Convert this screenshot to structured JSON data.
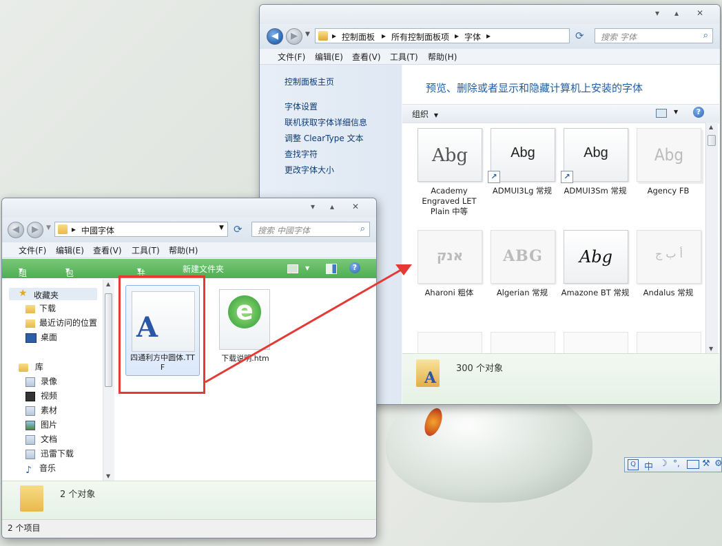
{
  "fonts_window": {
    "breadcrumb": [
      "控制面板",
      "所有控制面板项",
      "字体"
    ],
    "search_placeholder": "搜索 字体",
    "menus": [
      "文件(F)",
      "编辑(E)",
      "查看(V)",
      "工具(T)",
      "帮助(H)"
    ],
    "sidebar": {
      "home": "控制面板主页",
      "links": [
        "字体设置",
        "联机获取字体详细信息",
        "调整 ClearType 文本",
        "查找字符",
        "更改字体大小"
      ]
    },
    "heading": "预览、删除或者显示和隐藏计算机上安装的字体",
    "organize": "组织",
    "fonts": [
      {
        "preview": "Abg",
        "name": "Academy Engraved LET Plain 中等",
        "shortcut": false,
        "style": "serif",
        "stack": false
      },
      {
        "preview": "Abg",
        "name": "ADMUI3Lg 常规",
        "shortcut": true,
        "style": "sans",
        "stack": false
      },
      {
        "preview": "Abg",
        "name": "ADMUI3Sm 常规",
        "shortcut": true,
        "style": "sans",
        "stack": false
      },
      {
        "preview": "Abg",
        "name": "Agency FB",
        "shortcut": false,
        "style": "light",
        "stack": true
      },
      {
        "preview": "אנק",
        "name": "Aharoni 粗体",
        "shortcut": false,
        "style": "hebrew",
        "stack": false
      },
      {
        "preview": "ABG",
        "name": "Algerian 常规",
        "shortcut": false,
        "style": "algerian",
        "stack": false
      },
      {
        "preview": "Abg",
        "name": "Amazone BT 常规",
        "shortcut": false,
        "style": "script",
        "stack": false
      },
      {
        "preview": "أ ب ج",
        "name": "Andalus 常规",
        "shortcut": false,
        "style": "arabic",
        "stack": false
      }
    ],
    "status": "300 个对象"
  },
  "folder_window": {
    "breadcrumb": [
      "中國字体"
    ],
    "search_placeholder": "搜索 中國字体",
    "menus": [
      "文件(F)",
      "编辑(E)",
      "查看(V)",
      "工具(T)",
      "帮助(H)"
    ],
    "toolbar": [
      "组织",
      "包含到库中",
      "共享",
      "新建文件夹"
    ],
    "nav": {
      "favorites_title": "收藏夹",
      "favorites": [
        "下载",
        "最近访问的位置",
        "桌面"
      ],
      "libraries_title": "库",
      "libraries": [
        "录像",
        "视频",
        "素材",
        "图片",
        "文档",
        "迅雷下载",
        "音乐"
      ]
    },
    "files": [
      {
        "name": "四通利方中圆体.TTF",
        "type": "font",
        "icon_letter": "A"
      },
      {
        "name": "下载说明.htm",
        "type": "html",
        "icon_letter": "e"
      }
    ],
    "details_count": "2 个对象",
    "status_bar": "2 个项目"
  },
  "ime_bar": [
    "中"
  ],
  "colors": {
    "accent_green": "#5cb85c",
    "link_blue": "#0b4fa5",
    "heading_blue": "#1f5fa8",
    "highlight_red": "#e53935"
  }
}
